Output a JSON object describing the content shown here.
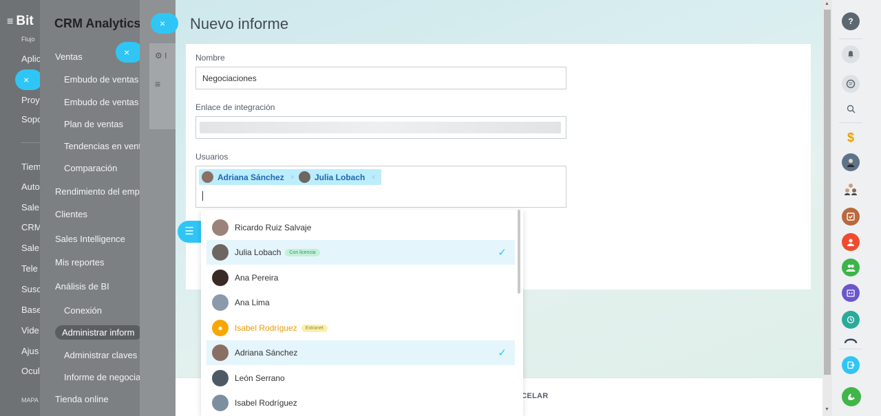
{
  "left_nav": {
    "logo": "Bit",
    "items": [
      "Flujo",
      "Aplic",
      "Proy",
      "Sopo",
      "Tiem",
      "Auto",
      "Sale",
      "CRM",
      "Sale",
      "Tele",
      "Susc",
      "Base",
      "Vide",
      "Ajus",
      "Ocul",
      "MAPA"
    ]
  },
  "crm_panel": {
    "title": "CRM Analytics",
    "items": [
      "Ventas",
      "Embudo de ventas",
      "Embudo de ventas",
      "Plan de ventas",
      "Tendencias en vent",
      "Comparación",
      "Rendimiento del emp",
      "Clientes",
      "Sales Intelligence",
      "Mis reportes",
      "Análisis de BI",
      "Conexión",
      "Administrar inform",
      "Administrar claves",
      "Informe de negocia",
      "Tienda online"
    ]
  },
  "underlying_page": {
    "toolbar_text": "I"
  },
  "slider": {
    "close_glyph": "×",
    "title": "Nuevo informe",
    "form": {
      "name_label": "Nombre",
      "name_value": "Negociaciones",
      "link_label": "Enlace de integración",
      "users_label": "Usuarios",
      "selected_users": [
        {
          "name": "Adriana Sánchez",
          "remove": "×"
        },
        {
          "name": "Julia Lobach",
          "remove": "×"
        }
      ]
    },
    "footer": {
      "cancel_label": "NCELAR"
    }
  },
  "dropdown": {
    "users": [
      {
        "name": "Ricardo Ruiz Salvaje",
        "selected": false
      },
      {
        "name": "Julia Lobach",
        "badge": "Con licencia",
        "selected": true
      },
      {
        "name": "Ana Pereira",
        "selected": false
      },
      {
        "name": "Ana Lima",
        "selected": false
      },
      {
        "name": "Isabel Rodríguez",
        "badge": "Extranet",
        "selected": false
      },
      {
        "name": "Adriana Sánchez",
        "selected": true
      },
      {
        "name": "León Serrano",
        "selected": false
      },
      {
        "name": "Isabel Rodríguez",
        "selected": false
      }
    ],
    "check_glyph": "✓"
  },
  "right_rail": {
    "buttons": [
      "help-icon",
      "notifications-icon",
      "chat-icon",
      "search-icon",
      "sales-icon",
      "user-avatar",
      "group-avatar",
      "tasks-icon",
      "contact-icon",
      "team-icon",
      "calendar-icon",
      "schedule-icon",
      "meeting-icon",
      "drive-icon",
      "call-icon"
    ]
  },
  "colors": {
    "accent": "#2fc6f6",
    "tag_bg": "#bcedfc",
    "selected_row": "#e5f5fc"
  }
}
